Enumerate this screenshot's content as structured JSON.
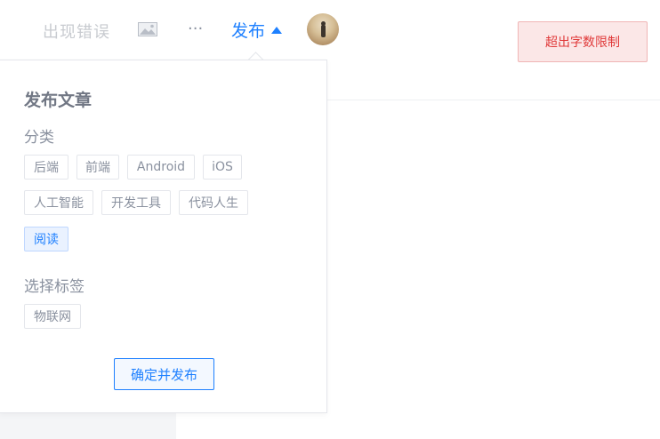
{
  "header": {
    "error_text": "出现错误",
    "image_icon": "image-icon",
    "more_icon": "more-icon",
    "more_glyph": "···",
    "publish_label": "发布",
    "avatar_icon": "avatar"
  },
  "alert": {
    "text": "超出字数限制"
  },
  "publish_panel": {
    "title": "发布文章",
    "category_label": "分类",
    "categories": [
      {
        "label": "后端",
        "selected": false
      },
      {
        "label": "前端",
        "selected": false
      },
      {
        "label": "Android",
        "selected": false
      },
      {
        "label": "iOS",
        "selected": false
      },
      {
        "label": "人工智能",
        "selected": false
      },
      {
        "label": "开发工具",
        "selected": false
      },
      {
        "label": "代码人生",
        "selected": false
      },
      {
        "label": "阅读",
        "selected": true
      }
    ],
    "tags_label": "选择标签",
    "tags": [
      {
        "label": "物联网"
      }
    ],
    "confirm_label": "确定并发布"
  },
  "colors": {
    "accent": "#1e80ff",
    "error": "#e03a3a",
    "error_bg": "#fbe7e7",
    "muted_text": "#8a919f"
  }
}
